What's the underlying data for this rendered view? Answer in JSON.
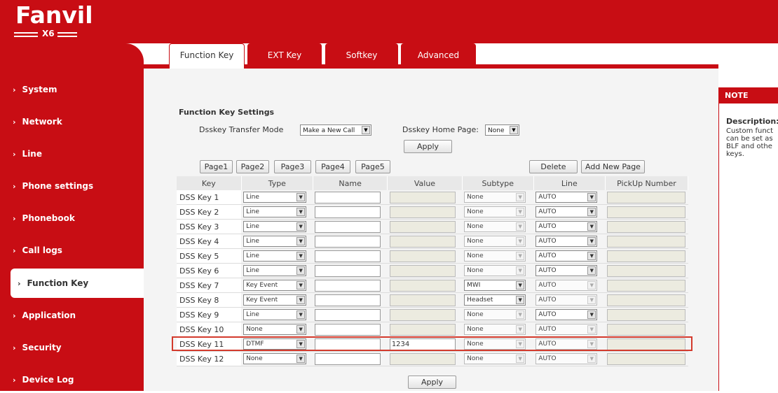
{
  "header": {
    "brand": "Fanvil",
    "model": "X6"
  },
  "sidebar": {
    "items": [
      {
        "label": "System"
      },
      {
        "label": "Network"
      },
      {
        "label": "Line"
      },
      {
        "label": "Phone settings"
      },
      {
        "label": "Phonebook"
      },
      {
        "label": "Call logs"
      },
      {
        "label": "Function Key",
        "active": true
      },
      {
        "label": "Application"
      },
      {
        "label": "Security"
      },
      {
        "label": "Device Log"
      }
    ],
    "chevron": "›"
  },
  "tabs": [
    {
      "label": "Function Key",
      "active": true
    },
    {
      "label": "EXT Key"
    },
    {
      "label": "Softkey"
    },
    {
      "label": "Advanced"
    }
  ],
  "settings": {
    "title": "Function Key Settings",
    "transfer_mode_label": "Dsskey Transfer Mode",
    "transfer_mode_value": "Make a New Call",
    "home_page_label": "Dsskey Home Page:",
    "home_page_value": "None",
    "apply_label": "Apply"
  },
  "pages": [
    "Page1",
    "Page2",
    "Page3",
    "Page4",
    "Page5"
  ],
  "actions": {
    "delete_label": "Delete",
    "add_page_label": "Add New Page",
    "apply_label": "Apply"
  },
  "table": {
    "headers": [
      "Key",
      "Type",
      "Name",
      "Value",
      "Subtype",
      "Line",
      "PickUp Number"
    ],
    "rows": [
      {
        "key": "DSS Key 1",
        "type": "Line",
        "name": "",
        "value": "",
        "subtype": "None",
        "line": "AUTO",
        "value_enabled": false,
        "subtype_enabled": false,
        "line_enabled": true
      },
      {
        "key": "DSS Key 2",
        "type": "Line",
        "name": "",
        "value": "",
        "subtype": "None",
        "line": "AUTO",
        "value_enabled": false,
        "subtype_enabled": false,
        "line_enabled": true
      },
      {
        "key": "DSS Key 3",
        "type": "Line",
        "name": "",
        "value": "",
        "subtype": "None",
        "line": "AUTO",
        "value_enabled": false,
        "subtype_enabled": false,
        "line_enabled": true
      },
      {
        "key": "DSS Key 4",
        "type": "Line",
        "name": "",
        "value": "",
        "subtype": "None",
        "line": "AUTO",
        "value_enabled": false,
        "subtype_enabled": false,
        "line_enabled": true
      },
      {
        "key": "DSS Key 5",
        "type": "Line",
        "name": "",
        "value": "",
        "subtype": "None",
        "line": "AUTO",
        "value_enabled": false,
        "subtype_enabled": false,
        "line_enabled": true
      },
      {
        "key": "DSS Key 6",
        "type": "Line",
        "name": "",
        "value": "",
        "subtype": "None",
        "line": "AUTO",
        "value_enabled": false,
        "subtype_enabled": false,
        "line_enabled": true
      },
      {
        "key": "DSS Key 7",
        "type": "Key Event",
        "name": "",
        "value": "",
        "subtype": "MWI",
        "line": "AUTO",
        "value_enabled": false,
        "subtype_enabled": true,
        "line_enabled": false
      },
      {
        "key": "DSS Key 8",
        "type": "Key Event",
        "name": "",
        "value": "",
        "subtype": "Headset",
        "line": "AUTO",
        "value_enabled": false,
        "subtype_enabled": true,
        "line_enabled": false
      },
      {
        "key": "DSS Key 9",
        "type": "Line",
        "name": "",
        "value": "",
        "subtype": "None",
        "line": "AUTO",
        "value_enabled": false,
        "subtype_enabled": false,
        "line_enabled": true
      },
      {
        "key": "DSS Key 10",
        "type": "None",
        "name": "",
        "value": "",
        "subtype": "None",
        "line": "AUTO",
        "value_enabled": false,
        "subtype_enabled": false,
        "line_enabled": false
      },
      {
        "key": "DSS Key 11",
        "type": "DTMF",
        "name": "",
        "value": "1234",
        "subtype": "None",
        "line": "AUTO",
        "value_enabled": true,
        "subtype_enabled": false,
        "line_enabled": false
      },
      {
        "key": "DSS Key 12",
        "type": "None",
        "name": "",
        "value": "",
        "subtype": "None",
        "line": "AUTO",
        "value_enabled": false,
        "subtype_enabled": false,
        "line_enabled": false
      }
    ]
  },
  "note": {
    "header": "NOTE",
    "title": "Description:",
    "lines": [
      "Custom funct",
      "can be set as",
      "BLF and othe",
      "keys."
    ]
  },
  "colors": {
    "brand_red": "#c80d14",
    "highlight": "#d33a2c"
  }
}
